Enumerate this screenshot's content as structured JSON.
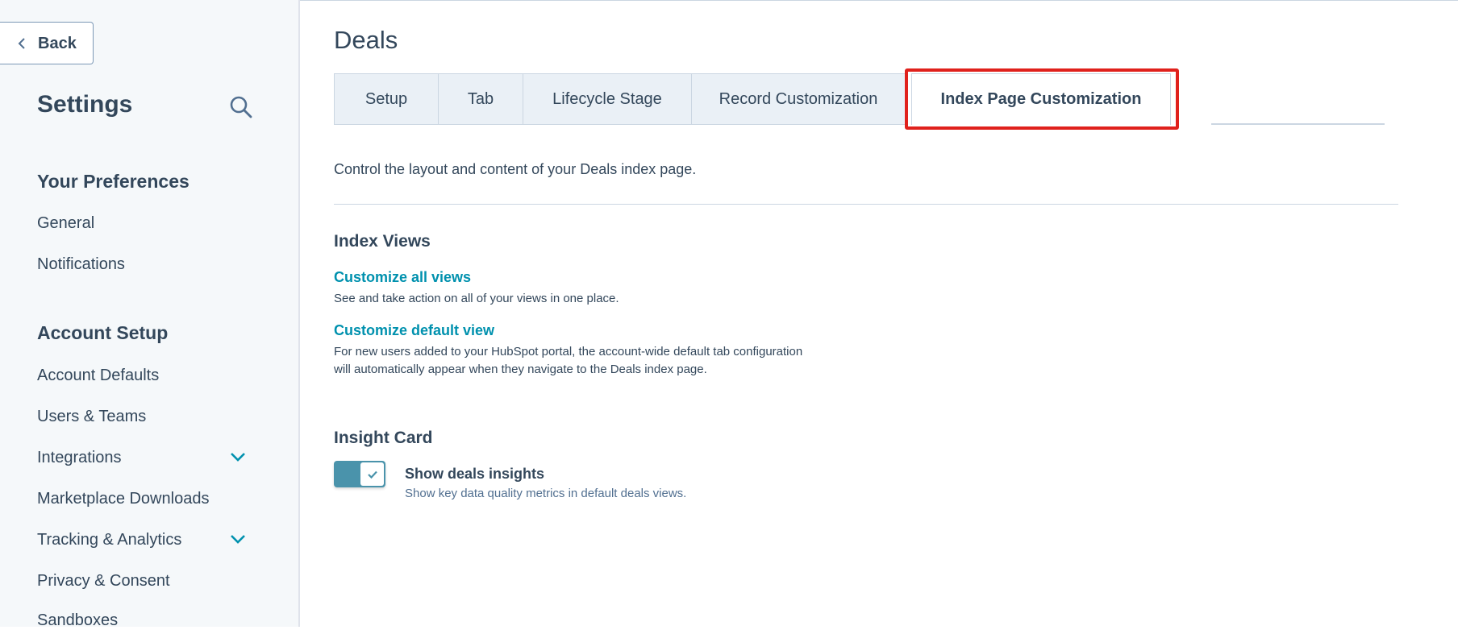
{
  "sidebar": {
    "back_label": "Back",
    "title": "Settings",
    "sections": [
      {
        "heading": "Your Preferences",
        "items": [
          {
            "label": "General",
            "expandable": false
          },
          {
            "label": "Notifications",
            "expandable": false
          }
        ]
      },
      {
        "heading": "Account Setup",
        "items": [
          {
            "label": "Account Defaults",
            "expandable": false
          },
          {
            "label": "Users & Teams",
            "expandable": false
          },
          {
            "label": "Integrations",
            "expandable": true
          },
          {
            "label": "Marketplace Downloads",
            "expandable": false
          },
          {
            "label": "Tracking & Analytics",
            "expandable": true
          },
          {
            "label": "Privacy & Consent",
            "expandable": false
          },
          {
            "label": "Sandboxes",
            "expandable": false
          }
        ]
      }
    ]
  },
  "main": {
    "title": "Deals",
    "tabs": [
      {
        "label": "Setup",
        "active": false
      },
      {
        "label": "Tab",
        "active": false
      },
      {
        "label": "Lifecycle Stage",
        "active": false
      },
      {
        "label": "Record Customization",
        "active": false
      },
      {
        "label": "Index Page Customization",
        "active": true
      }
    ],
    "description": "Control the layout and content of your Deals index page.",
    "index_views": {
      "heading": "Index Views",
      "customize_all_link": "Customize all views",
      "customize_all_desc": "See and take action on all of your views in one place.",
      "customize_default_link": "Customize default view",
      "customize_default_desc_line1": "For new users added to your HubSpot portal, the account-wide default tab configuration",
      "customize_default_desc_line2": "will automatically appear when they navigate to the Deals index page."
    },
    "insight_card": {
      "heading": "Insight Card",
      "toggle_label": "Show deals insights",
      "toggle_desc": "Show key data quality metrics in default deals views.",
      "toggle_on": true
    }
  },
  "colors": {
    "accent": "#0091ae",
    "toggle_on": "#4a93ab",
    "highlight": "#e0211c",
    "text": "#33475b"
  }
}
